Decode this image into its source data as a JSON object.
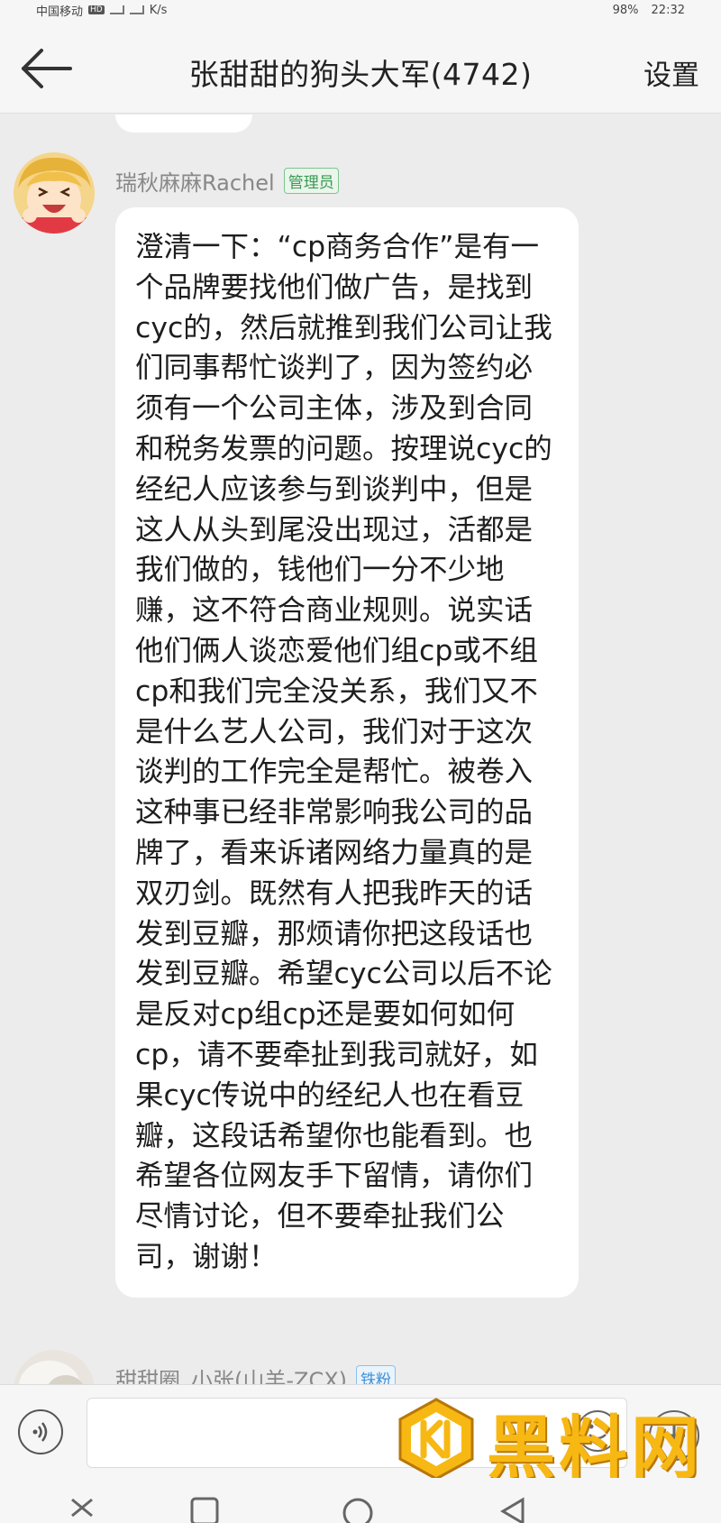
{
  "status_bar": {
    "carrier": "中国移动",
    "network_badge": "HD",
    "speed_unit": "K/s",
    "battery": "98%",
    "time": "22:32"
  },
  "header": {
    "back_icon": "arrow-left-icon",
    "title": "张甜甜的狗头大军(4742)",
    "settings_label": "设置"
  },
  "messages": [
    {
      "sender": "瑞秋麻麻Rachel",
      "badge": "管理员",
      "text": "澄清一下：“cp商务合作”是有一个品牌要找他们做广告，是找到cyc的，然后就推到我们公司让我们同事帮忙谈判了，因为签约必须有一个公司主体，涉及到合同和税务发票的问题。按理说cyc的经纪人应该参与到谈判中，但是这人从头到尾没出现过，活都是我们做的，钱他们一分不少地赚，这不符合商业规则。说实话他们俩人谈恋爱他们组cp或不组cp和我们完全没关系，我们又不是什么艺人公司，我们对于这次谈判的工作完全是帮忙。被卷入这种事已经非常影响我公司的品牌了，看来诉诸网络力量真的是双刃剑。既然有人把我昨天的话发到豆瓣，那烦请你把这段话也发到豆瓣。希望cyc公司以后不论是反对cp组cp还是要如何如何cp，请不要牵扯到我司就好，如果cyc传说中的经纪人也在看豆瓣，这段话希望你也能看到。也希望各位网友手下留情，请你们尽情讨论，但不要牵扯我们公司，谢谢！"
    },
    {
      "sender": "甜甜圈_小张(山羊-ZCX)",
      "badge": "铁粉"
    }
  ],
  "input_bar": {
    "voice_icon": "voice-icon",
    "emoji_icon": "emoji-icon",
    "plus_icon": "plus-icon"
  },
  "watermark": {
    "text": "黑料网",
    "url": "https://hlwe7.com"
  },
  "nav_bar": {
    "icons": [
      "back-nav-icon",
      "home-nav-icon",
      "recents-nav-icon"
    ]
  },
  "colors": {
    "background": "#ececec",
    "admin_badge": "#3a9a52",
    "fan_badge": "#3d8fd6",
    "watermark": "#f7b813"
  }
}
